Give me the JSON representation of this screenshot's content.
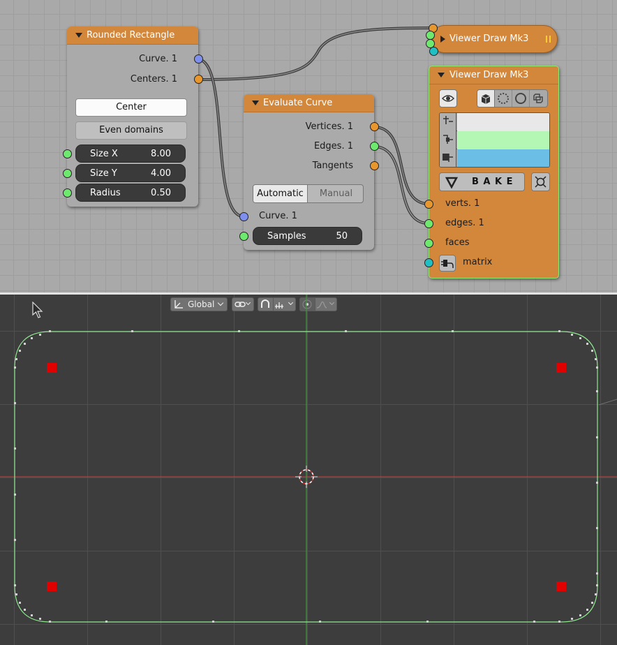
{
  "node_rounded_rect": {
    "title": "Rounded Rectangle",
    "outputs": [
      "Curve. 1",
      "Centers. 1"
    ],
    "center_button": "Center",
    "even_domains_button": "Even domains",
    "sliders": [
      {
        "label": "Size X",
        "value": "8.00"
      },
      {
        "label": "Size Y",
        "value": "4.00"
      },
      {
        "label": "Radius",
        "value": "0.50"
      }
    ]
  },
  "node_evaluate_curve": {
    "title": "Evaluate Curve",
    "outputs": [
      "Vertices. 1",
      "Edges. 1",
      "Tangents"
    ],
    "mode_options": [
      "Automatic",
      "Manual"
    ],
    "selected_mode": "Automatic",
    "input": "Curve. 1",
    "samples": {
      "label": "Samples",
      "value": "50"
    }
  },
  "node_viewer_collapsed": {
    "title": "Viewer Draw Mk3"
  },
  "node_viewer": {
    "title": "Viewer Draw Mk3",
    "bake_label": "B A K E",
    "inputs": [
      "verts. 1",
      "edges. 1",
      "faces",
      "matrix"
    ],
    "color_swatches": [
      "#e8e8e8",
      "#b4f7b4",
      "#6bbfe7"
    ]
  },
  "viewport_toolbar": {
    "orientation": "Global"
  },
  "colors": {
    "node_header": "#d3873b",
    "node_body": "#aaaaaa",
    "socket_green": "#6dea6d",
    "socket_blue": "#7f8fee",
    "socket_orange": "#e8962e",
    "socket_cyan": "#1fbfc4",
    "curve_green": "#8fe88f",
    "center_red": "#e00000"
  }
}
